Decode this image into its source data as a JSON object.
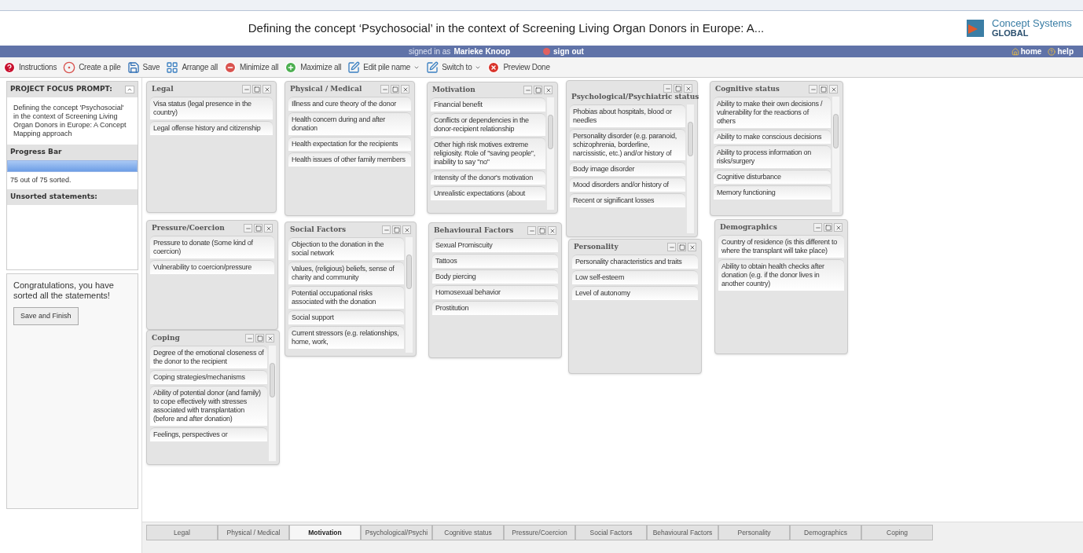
{
  "header": {
    "title": "Defining the concept ‘Psychosocial’ in the context of Screening Living Organ Donors in Europe: A...",
    "logo_line1": "Concept Systems",
    "logo_line2": "GLOBAL"
  },
  "user_bar": {
    "signed_in_label": "signed in as",
    "user": "Marieke Knoop",
    "sign_out": "sign out",
    "home": "home",
    "help": "help"
  },
  "toolbar": [
    {
      "label": "Instructions",
      "kind": "help",
      "dropdown": false
    },
    {
      "label": "Create a pile",
      "kind": "create",
      "dropdown": false
    },
    {
      "label": "Save",
      "kind": "save",
      "dropdown": false
    },
    {
      "label": "Arrange all",
      "kind": "arrange",
      "dropdown": false
    },
    {
      "label": "Minimize all",
      "kind": "minimize",
      "dropdown": false
    },
    {
      "label": "Maximize all",
      "kind": "maximize",
      "dropdown": false
    },
    {
      "label": "Edit pile name",
      "kind": "edit",
      "dropdown": true
    },
    {
      "label": "Switch to",
      "kind": "edit",
      "dropdown": true
    },
    {
      "label": "Preview Done",
      "kind": "done",
      "dropdown": false
    }
  ],
  "sidebar": {
    "focus_title": "PROJECT FOCUS PROMPT:",
    "focus_text": "Defining the concept 'Psychosocial' in the context of Screening Living Organ Donors in Europe: A Concept Mapping approach",
    "progress_title": "Progress Bar",
    "progress": {
      "level": 1.0
    },
    "progress_text": "75 out of 75 sorted.",
    "unsorted_title": "Unsorted statements:",
    "message": "Congratulations, you have sorted all the statements!",
    "finish_button": "Save and Finish"
  },
  "piles": [
    {
      "title": "Legal",
      "kind": "plain",
      "items": [
        "Visa status (legal presence in the country)",
        "Legal offense history and citizenship"
      ]
    },
    {
      "title": "Physical / Medical",
      "kind": "plain",
      "items": [
        "Illness and cure theory of the donor",
        "Health concern during and after donation",
        "Health expectation for the recipients",
        "Health issues of other family members"
      ]
    },
    {
      "title": "Motivation",
      "kind": "scrolling",
      "items": [
        "Financial benefit",
        "Conflicts or dependencies in the donor-recipient relationship",
        "Other high risk motives extreme religiosity. Role of \"saving people\", inability to say \"no\"",
        "Intensity of the donor's motivation",
        "Unrealistic expectations (about"
      ]
    },
    {
      "title": "Psychological/Psychiatric status",
      "kind": "scrolling",
      "items": [
        "Phobias about hospitals, blood or needles",
        "Personality disorder (e.g. paranoid, schizophrenia, borderline, narcissistic, etc.) and/or history of",
        "Body image disorder",
        "Mood disorders and/or history of",
        "Recent or significant losses"
      ]
    },
    {
      "title": "Cognitive status",
      "kind": "scrolling",
      "items": [
        "Ability to make their own decisions / vulnerability for the reactions of others",
        "Ability to make conscious decisions",
        "Ability to process information on risks/surgery",
        "Cognitive disturbance",
        "Memory functioning"
      ]
    },
    {
      "title": "Pressure/Coercion",
      "kind": "plain",
      "items": [
        "Pressure to donate (Some kind of coercion)",
        "Vulnerability to coercion/pressure"
      ]
    },
    {
      "title": "Social Factors",
      "kind": "scrolling",
      "items": [
        "Objection to the donation in the social network",
        "Values, (religious) beliefs, sense of charity and community",
        "Potential occupational risks associated with the donation",
        "Social support",
        "Current stressors (e.g. relationships, home, work,"
      ]
    },
    {
      "title": "Behavioural Factors",
      "kind": "plain",
      "items": [
        "Sexual Promiscuity",
        "Tattoos",
        "Body piercing",
        "Homosexual behavior",
        "Prostitution"
      ]
    },
    {
      "title": "Personality",
      "kind": "plain",
      "items": [
        "Personality characteristics and traits",
        "Low self-esteem",
        "Level of autonomy"
      ]
    },
    {
      "title": "Demographics",
      "kind": "plain",
      "items": [
        "Country of residence (is this different to where the transplant will take place)",
        "Ability to obtain health checks after donation (e.g. if the donor lives in another country)"
      ]
    },
    {
      "title": "Coping",
      "kind": "scrolling",
      "items": [
        "Degree of the emotional closeness of the donor to the recipient",
        "Coping strategies/mechanisms",
        "Ability of potential donor (and family) to cope effectively with stresses associated with transplantation (before and after donation)",
        "Feelings, perspectives or"
      ]
    }
  ],
  "tabs": [
    {
      "label": "Legal",
      "selected": false
    },
    {
      "label": "Physical / Medical",
      "selected": false
    },
    {
      "label": "Motivation",
      "selected": true
    },
    {
      "label": "Psychological/Psychi",
      "selected": false
    },
    {
      "label": "Cognitive status",
      "selected": false
    },
    {
      "label": "Pressure/Coercion",
      "selected": false
    },
    {
      "label": "Social Factors",
      "selected": false
    },
    {
      "label": "Behavioural Factors",
      "selected": false
    },
    {
      "label": "Personality",
      "selected": false
    },
    {
      "label": "Demographics",
      "selected": false
    },
    {
      "label": "Coping",
      "selected": false
    }
  ]
}
